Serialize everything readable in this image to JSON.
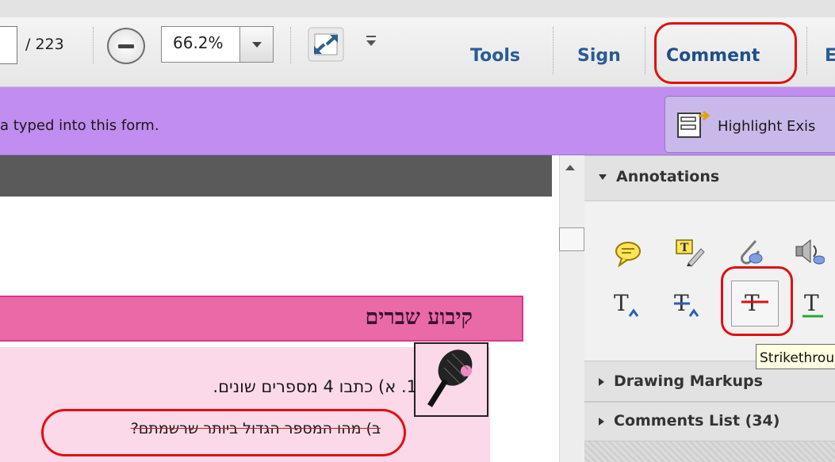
{
  "toolbar": {
    "page_count": "/ 223",
    "zoom_value": "66.2%",
    "tools_label": "Tools",
    "sign_label": "Sign",
    "comment_label": "Comment",
    "extra_label": "E"
  },
  "form_bar": {
    "message": "a typed into this form.",
    "highlight_button": "Highlight Exis"
  },
  "document": {
    "banner_title": "קיבוע שברים",
    "question_1": "1. א) כתבו 4 מספרים שונים.",
    "question_2": "ב) מהו המספר הגדול ביותר שרשמתם?"
  },
  "panel": {
    "annotations_header": "Annotations",
    "drawing_markups_header": "Drawing Markups",
    "comments_list_header": "Comments List (34)",
    "tooltip": "Strikethrough"
  },
  "colors": {
    "accent_link": "#2a5b98",
    "form_bar": "#c18df0",
    "highlight_circle": "#e01010",
    "banner_pink": "#ea6aa7",
    "block_pink": "#fbd9e8"
  }
}
